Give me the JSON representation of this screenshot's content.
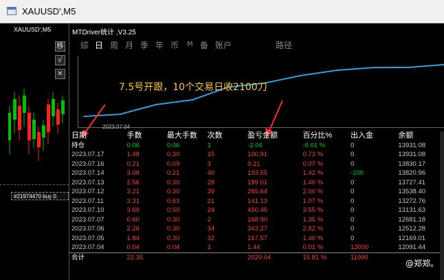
{
  "window": {
    "title": "XAUUSD',M5"
  },
  "chart": {
    "symbol_label": "XAUUSD',M5",
    "order_line": "#21974470 buy 0."
  },
  "toolbar": [
    "移",
    "√",
    "✕"
  ],
  "panel": {
    "title": "MTDriver统计 ,V3.25",
    "tabs": [
      "综",
      "日",
      "周",
      "月",
      "季",
      "年",
      "币",
      "M",
      "备",
      "账户",
      "路径"
    ],
    "active_tab": "日",
    "annotation": "7.5号开跟，10个交易日收2100刀",
    "start_date_tick": "2023.07.04"
  },
  "chart_data": {
    "type": "line",
    "x": [
      "2023.07.04",
      "2023.07.05",
      "2023.07.06",
      "2023.07.07",
      "2023.07.10",
      "2023.07.11",
      "2023.07.12",
      "2023.07.13",
      "2023.07.14",
      "2023.07.16",
      "2023.07.17"
    ],
    "y": [
      12091.44,
      12169.01,
      12512.28,
      12681.18,
      13131.63,
      13272.76,
      13538.4,
      13727.41,
      13820.96,
      13830.17,
      13931.08
    ]
  },
  "table": {
    "headers": [
      "日期",
      "手数",
      "最大手数",
      "次数",
      "盈亏金额",
      "百分比%",
      "出入金",
      "余额"
    ],
    "holding": [
      "持仓",
      "0.06",
      "0.06",
      "1",
      "-2.04",
      "-0.01 %",
      "0",
      "13931.08"
    ],
    "rows": [
      [
        "2023.07.17",
        "1.48",
        "0.30",
        "15",
        "100.91",
        "0.73 %",
        "0",
        "13931.08"
      ],
      [
        "2023.07.16",
        "0.21",
        "0.09",
        "3",
        "9.21",
        "0.07 %",
        "0",
        "13830.17"
      ],
      [
        "2023.07.14",
        "3.08",
        "0.21",
        "40",
        "193.55",
        "1.42 %",
        "-100",
        "13820.96"
      ],
      [
        "2023.07.13",
        "2.56",
        "0.30",
        "28",
        "189.01",
        "1.40 %",
        "0",
        "13727.41"
      ],
      [
        "2023.07.12",
        "3.21",
        "0.30",
        "39",
        "265.64",
        "2.00 %",
        "0",
        "13538.40"
      ],
      [
        "2023.07.11",
        "3.31",
        "0.63",
        "21",
        "141.13",
        "1.07 %",
        "0",
        "13272.76"
      ],
      [
        "2023.07.10",
        "3.69",
        "0.50",
        "24",
        "450.45",
        "3.55 %",
        "0",
        "13131.63"
      ],
      [
        "2023.07.07",
        "0.60",
        "0.30",
        "2",
        "168.90",
        "1.35 %",
        "0",
        "12681.18"
      ],
      [
        "2023.07.06",
        "2.26",
        "0.30",
        "34",
        "343.27",
        "2.82 %",
        "0",
        "12512.28"
      ],
      [
        "2023.07.05",
        "1.84",
        "0.30",
        "32",
        "167.57",
        "1.40 %",
        "0",
        "12169.01"
      ],
      [
        "2023.07.04",
        "0.04",
        "0.04",
        "1",
        "1.44",
        "0.01 %",
        "12000",
        "12091.44"
      ]
    ],
    "total": [
      "合计",
      "22.35",
      "",
      "",
      "2029.04",
      "15.81 %",
      "11900",
      ""
    ]
  },
  "watermark": "@郑郑。",
  "colors": {
    "green": "#00d400",
    "red": "#ff3b3b",
    "annotation": "#ffc933",
    "curve": "#29a3e0"
  }
}
